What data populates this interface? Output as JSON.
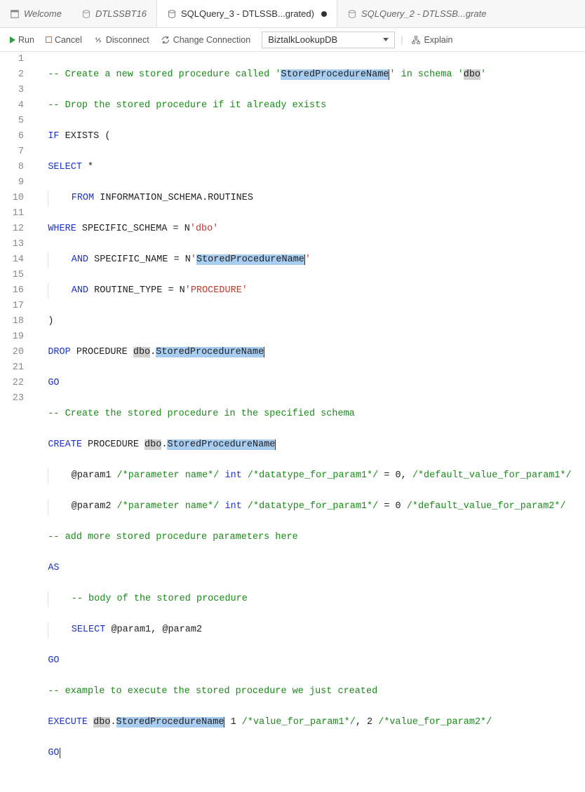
{
  "tabs": [
    {
      "label": "Welcome",
      "icon": "welcome"
    },
    {
      "label": "DTLSSBT16",
      "icon": "db"
    },
    {
      "label": "SQLQuery_3 - DTLSSB...grated)",
      "icon": "db",
      "active": true,
      "dirty": true
    },
    {
      "label": "SQLQuery_2 - DTLSSB...grate",
      "icon": "db"
    }
  ],
  "toolbar": {
    "run": "Run",
    "cancel": "Cancel",
    "disconnect": "Disconnect",
    "change_connection": "Change Connection",
    "db_selected": "BiztalkLookupDB",
    "explain": "Explain"
  },
  "code": {
    "l1_a": "-- Create a new stored procedure called '",
    "l1_hl": "StoredProcedureName",
    "l1_b": "' in schema '",
    "l1_hl2": "dbo",
    "l1_c": "'",
    "l2": "-- Drop the stored procedure if it already exists",
    "l3_a": "IF",
    "l3_b": " EXISTS (",
    "l4_a": "SELECT",
    "l4_b": " *",
    "l5_a": "FROM",
    "l5_b": " INFORMATION_SCHEMA.ROUTINES",
    "l6_a": "WHERE",
    "l6_b": " SPECIFIC_SCHEMA = N",
    "l6_c": "'dbo'",
    "l7_a": "AND",
    "l7_b": " SPECIFIC_NAME = N",
    "l7_c": "'",
    "l7_hl": "StoredProcedureName",
    "l7_d": "'",
    "l8_a": "AND",
    "l8_b": " ROUTINE_TYPE = N",
    "l8_c": "'PROCEDURE'",
    "l9": ")",
    "l10_a": "DROP",
    "l10_b": " PROCEDURE ",
    "l10_c": "dbo",
    "l10_d": ".",
    "l10_hl": "StoredProcedureName",
    "l11": "GO",
    "l12": "-- Create the stored procedure in the specified schema",
    "l13_a": "CREATE",
    "l13_b": " PROCEDURE ",
    "l13_c": "dbo",
    "l13_d": ".",
    "l13_hl": "StoredProcedureName",
    "l14_a": "@param1 ",
    "l14_b": "/*parameter name*/",
    "l14_c": " ",
    "l14_d": "int",
    "l14_e": " ",
    "l14_f": "/*datatype_for_param1*/",
    "l14_g": " = 0, ",
    "l14_h": "/*default_value_for_param1*/",
    "l15_a": "@param2 ",
    "l15_b": "/*parameter name*/",
    "l15_c": " ",
    "l15_d": "int",
    "l15_e": " ",
    "l15_f": "/*datatype_for_param1*/",
    "l15_g": " = 0 ",
    "l15_h": "/*default_value_for_param2*/",
    "l16": "-- add more stored procedure parameters here",
    "l17": "AS",
    "l18": "-- body of the stored procedure",
    "l19_a": "SELECT",
    "l19_b": " @param1, @param2",
    "l20": "GO",
    "l21": "-- example to execute the stored procedure we just created",
    "l22_a": "EXECUTE ",
    "l22_b": "dbo",
    "l22_c": ".",
    "l22_hl": "StoredProcedureName",
    "l22_d": " 1 ",
    "l22_e": "/*value_for_param1*/",
    "l22_f": ", 2 ",
    "l22_g": "/*value_for_param2*/",
    "l23": "GO"
  },
  "line_numbers": [
    "1",
    "2",
    "3",
    "4",
    "5",
    "6",
    "7",
    "8",
    "9",
    "10",
    "11",
    "12",
    "13",
    "14",
    "15",
    "16",
    "17",
    "18",
    "19",
    "20",
    "21",
    "22",
    "23"
  ]
}
